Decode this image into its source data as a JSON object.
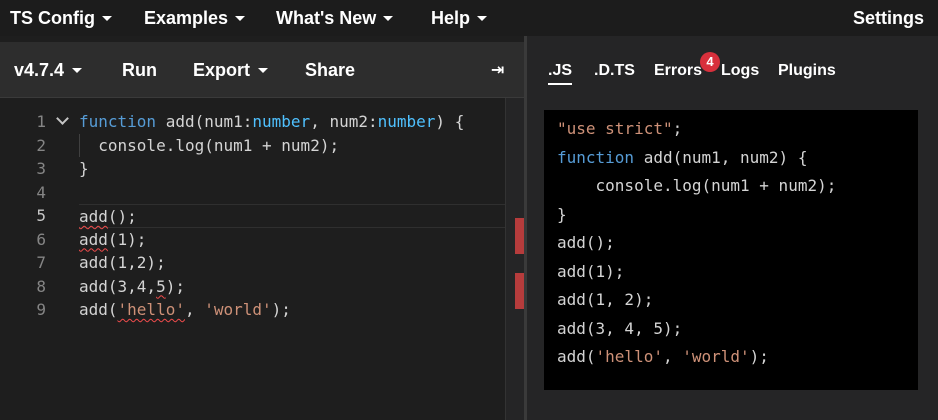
{
  "nav": {
    "items": [
      "TS Config",
      "Examples",
      "What's New",
      "Help"
    ],
    "settings": "Settings"
  },
  "toolbar": {
    "version": "v4.7.4",
    "run": "Run",
    "export": "Export",
    "share": "Share",
    "collapse_icon": "⇥"
  },
  "editor": {
    "line_numbers": [
      "1",
      "2",
      "3",
      "4",
      "5",
      "6",
      "7",
      "8",
      "9"
    ],
    "active_line": "5",
    "lines": [
      "function add(num1:number, num2:number) {",
      "  console.log(num1 + num2);",
      "}",
      "",
      "add();",
      "add(1);",
      "add(1,2);",
      "add(3,4,5);",
      "add('hello', 'world');"
    ]
  },
  "output_tabs": {
    "js": ".JS",
    "dts": ".D.TS",
    "errors": "Errors",
    "errors_count": "4",
    "logs": "Logs",
    "plugins": "Plugins"
  },
  "output": {
    "lines": [
      "\"use strict\";",
      "function add(num1, num2) {",
      "    console.log(num1 + num2);",
      "}",
      "add();",
      "add(1);",
      "add(1, 2);",
      "add(3, 4, 5);",
      "add('hello', 'world');"
    ]
  },
  "colors": {
    "keyword": "#569cd6",
    "type": "#4fc1ff",
    "string": "#ce9178",
    "error": "#f14c4c",
    "badge": "#d8303c"
  }
}
